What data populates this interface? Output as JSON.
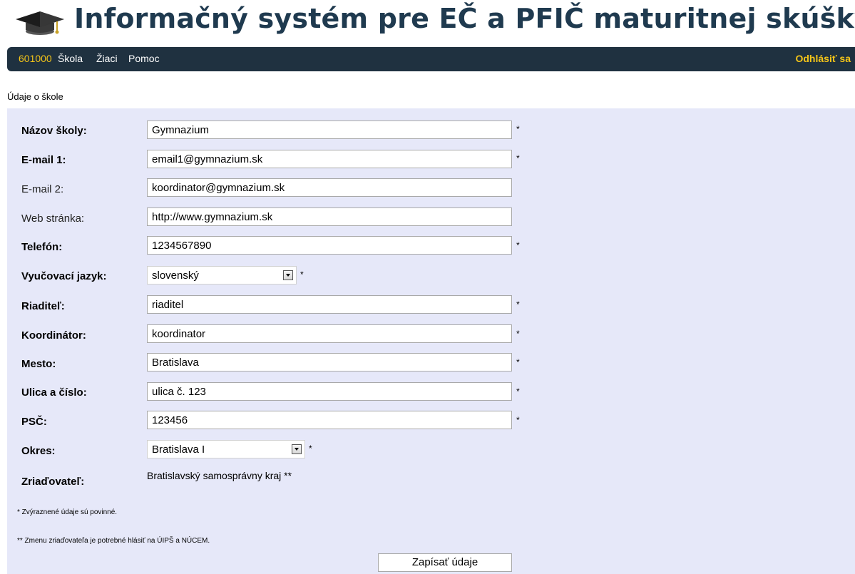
{
  "header": {
    "title": "Informačný systém pre EČ a PFIČ maturitnej skúšky",
    "logo_icon": "graduation-cap-icon"
  },
  "nav": {
    "school_id": "601000",
    "skola": "Škola",
    "ziaci": "Žiaci",
    "pomoc": "Pomoc",
    "logout": "Odhlásiť sa"
  },
  "section": {
    "title": "Údaje o škole"
  },
  "form": {
    "nazov": {
      "label": "Názov školy:",
      "value": "Gymnazium",
      "marker": "*"
    },
    "email1": {
      "label": "E-mail 1:",
      "value": "email1@gymnazium.sk",
      "marker": "*"
    },
    "email2": {
      "label": "E-mail 2:",
      "value": "koordinator@gymnazium.sk"
    },
    "web": {
      "label": "Web stránka:",
      "value": "http://www.gymnazium.sk"
    },
    "telefon": {
      "label": "Telefón:",
      "value": "1234567890",
      "marker": "*"
    },
    "jazyk": {
      "label": "Vyučovací jazyk:",
      "value": "slovenský",
      "marker": "*"
    },
    "riaditel": {
      "label": "Riaditeľ:",
      "value": "riaditel",
      "marker": "*"
    },
    "koordinator": {
      "label": "Koordinátor:",
      "value": "koordinator",
      "marker": "*"
    },
    "mesto": {
      "label": "Mesto:",
      "value": "Bratislava",
      "marker": "*"
    },
    "ulica": {
      "label": "Ulica a číslo:",
      "value": "ulica č. 123",
      "marker": "*"
    },
    "psc": {
      "label": "PSČ:",
      "value": "123456",
      "marker": "*"
    },
    "okres": {
      "label": "Okres:",
      "value": "Bratislava I",
      "marker": "*"
    },
    "zriadovatel": {
      "label": "Zriaďovateľ:",
      "value": "Bratislavský samosprávny kraj  **"
    }
  },
  "notes": {
    "required": "* Zvýraznené údaje sú povinné.",
    "founder": "** Zmenu zriaďovateľa je potrebné hlásiť na ÚIPŠ a NÚCEM."
  },
  "submit": {
    "label": "Zapísať údaje"
  },
  "colors": {
    "navbar": "#1f3140",
    "nav_accent": "#f5c518",
    "panel": "#e6e8f9",
    "title": "#1f3a4f"
  }
}
